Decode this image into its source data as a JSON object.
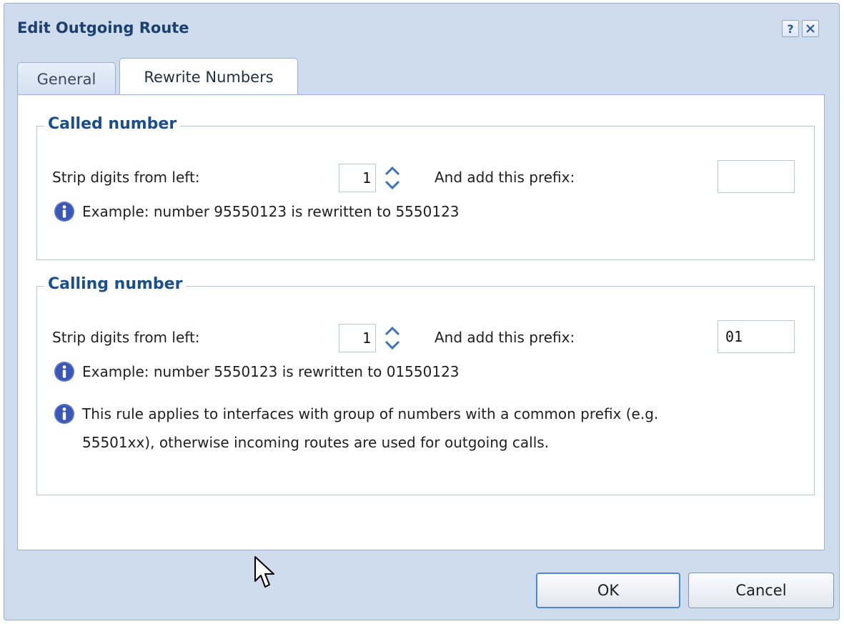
{
  "dialog": {
    "title": "Edit Outgoing Route",
    "help_icon": "question-icon",
    "close_icon": "close-icon"
  },
  "tabs": [
    {
      "label": "General",
      "active": false
    },
    {
      "label": "Rewrite Numbers",
      "active": true
    }
  ],
  "called": {
    "legend": "Called number",
    "strip_label": "Strip digits from left:",
    "strip_value": "1",
    "prefix_label": "And add this prefix:",
    "prefix_value": "",
    "example": "Example: number 95550123 is rewritten to 5550123"
  },
  "calling": {
    "legend": "Calling number",
    "strip_label": "Strip digits from left:",
    "strip_value": "1",
    "prefix_label": "And add this prefix:",
    "prefix_value": "01",
    "example": "Example: number 5550123 is rewritten to 01550123",
    "note_line1": "This rule applies to interfaces with group of numbers with a common prefix (e.g.",
    "note_line2": "55501xx), otherwise incoming routes are used for outgoing calls."
  },
  "footer": {
    "ok_label": "OK",
    "cancel_label": "Cancel"
  },
  "colors": {
    "dialog_bg": "#cfdcee",
    "title": "#1b3f6f",
    "legend": "#1b4f8c",
    "info_icon": "#3b57b6",
    "ok_border": "#4a89cf"
  }
}
